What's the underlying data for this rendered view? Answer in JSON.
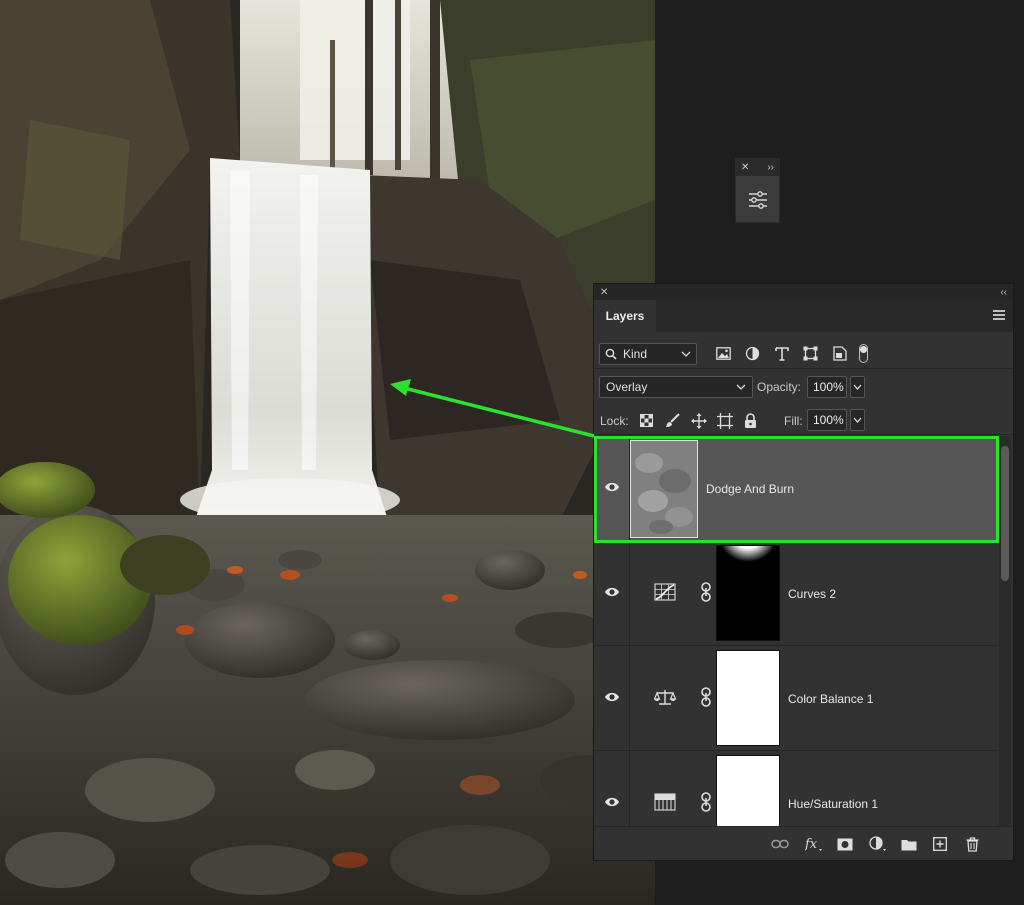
{
  "layers_panel": {
    "tab_label": "Layers",
    "filter": {
      "kind_label": "Kind"
    },
    "blend_mode": "Overlay",
    "opacity_label": "Opacity:",
    "opacity_value": "100%",
    "lock_label": "Lock:",
    "fill_label": "Fill:",
    "fill_value": "100%",
    "layers": [
      {
        "name": "Dodge And Burn",
        "selected": true,
        "type": "pixel"
      },
      {
        "name": "Curves 2",
        "selected": false,
        "type": "curves-adjustment"
      },
      {
        "name": "Color Balance 1",
        "selected": false,
        "type": "color-balance-adjustment"
      },
      {
        "name": "Hue/Saturation 1",
        "selected": false,
        "type": "hue-saturation-adjustment"
      }
    ]
  },
  "mini_panel": {
    "icon": "adjustments-icon"
  },
  "colors": {
    "highlight": "#2ee02e",
    "panel_bg": "#323232",
    "selected_layer_bg": "#565656"
  }
}
